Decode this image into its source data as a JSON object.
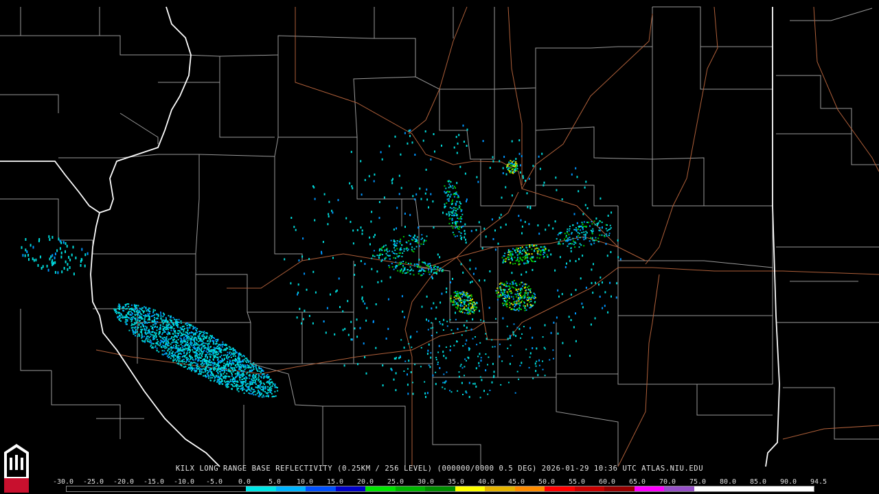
{
  "caption": "KILX LONG RANGE BASE REFLECTIVITY (0.25KM / 256 LEVEL) (000000/0000 0.5 DEG) 2026-01-29 10:36 UTC  ATLAS.NIU.EDU",
  "logo_text": "NIU",
  "scale": {
    "labels": [
      "-30.0",
      "-25.0",
      "-20.0",
      "-15.0",
      "-10.0",
      "-5.0",
      "0.0",
      "5.0",
      "10.0",
      "15.0",
      "20.0",
      "25.0",
      "30.0",
      "35.0",
      "40.0",
      "45.0",
      "50.0",
      "55.0",
      "60.0",
      "65.0",
      "70.0",
      "75.0",
      "80.0",
      "85.0",
      "90.0",
      "94.5"
    ],
    "colors": [
      "#000000",
      "#000000",
      "#000000",
      "#000000",
      "#000000",
      "#000000",
      "#00e6e6",
      "#00b4ff",
      "#0050ff",
      "#0000c8",
      "#00e600",
      "#00b400",
      "#008c00",
      "#ffff00",
      "#e6b400",
      "#ff8c00",
      "#ff0000",
      "#c80000",
      "#960000",
      "#ff00ff",
      "#9650c8",
      "#ffffff",
      "#ffffff",
      "#ffffff",
      "#ffffff"
    ]
  },
  "colors": {
    "background": "#000000",
    "county_lines": "#9a9a9a",
    "state_lines": "#ffffff",
    "highways": "#b0603a",
    "echo_light": "#00dcdc",
    "echo_mid": "#0096ff",
    "echo_green": "#00c800",
    "echo_yellow": "#e6e600"
  }
}
